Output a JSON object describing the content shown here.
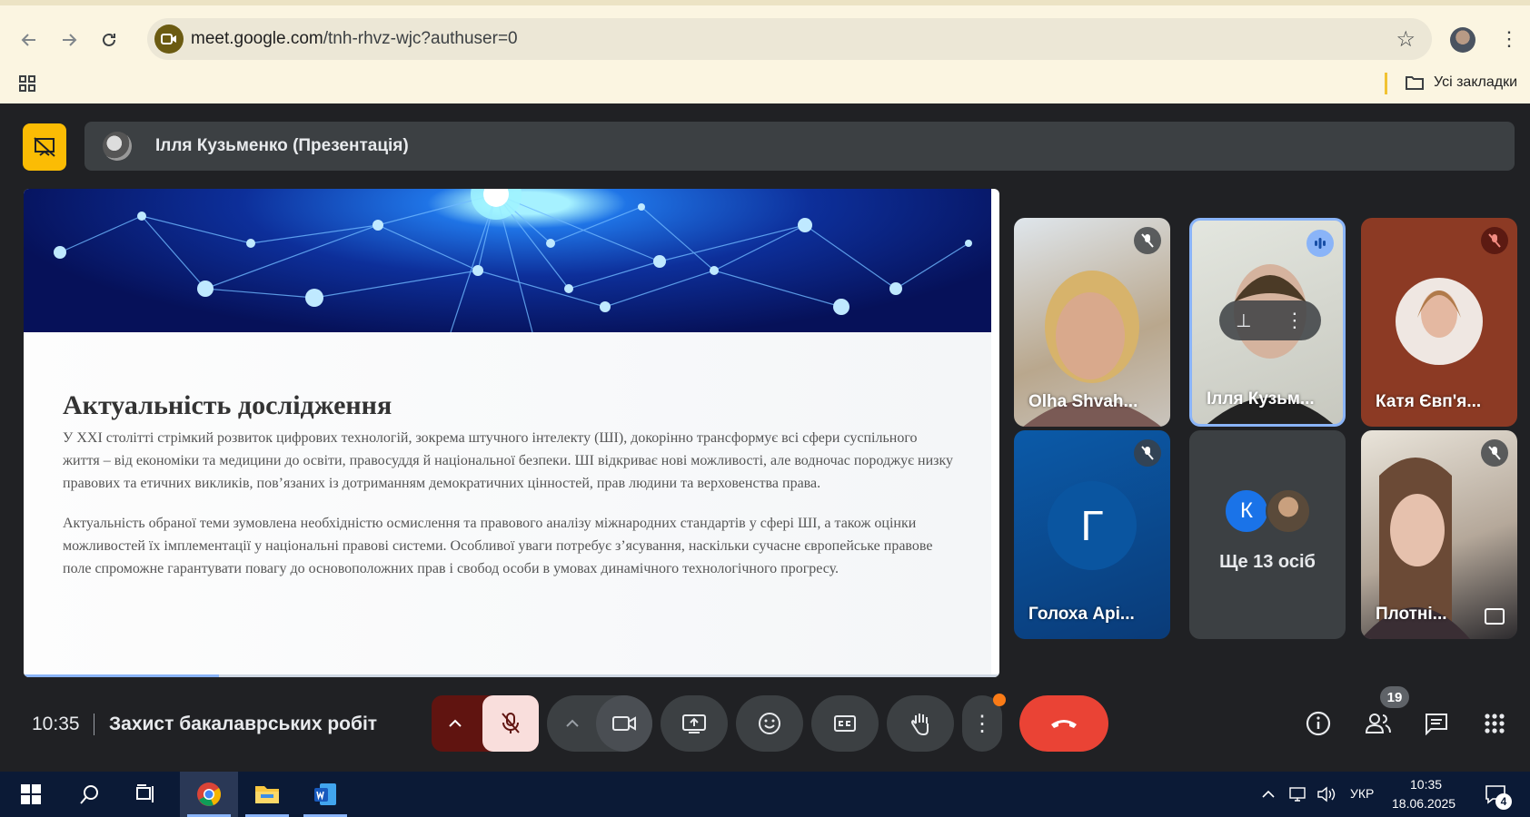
{
  "browser": {
    "url_host": "meet.google.com",
    "url_path": "/tnh-rhvz-wjc?authuser=0",
    "bookmarks_label": "Усі закладки"
  },
  "meet": {
    "presenter_title": "Ілля Кузьменко (Презентація)",
    "slide": {
      "heading": "Актуальність дослідження",
      "paragraph1": "У XXI столітті стрімкий розвиток цифрових технологій, зокрема штучного інтелекту (ШІ), докорінно трансформує всі сфери суспільного життя – від економіки та медицини до освіти, правосуддя й національної безпеки. ШІ відкриває нові можливості, але водночас породжує низку правових та етичних викликів, пов’язаних із дотриманням демократичних цінностей, прав людини та верховенства права.",
      "paragraph2": "Актуальність обраної теми зумовлена необхідністю осмислення та правового аналізу міжнародних стандартів у сфері ШІ, а також оцінки можливостей їх імплементації у національні правові системи. Особливої уваги потребує з’ясування, наскільки сучасне європейське правове поле спроможне гарантувати повагу до основоположних прав і свобод особи в умовах динамічного технологічного прогресу.",
      "progress": 0.2
    },
    "participants": [
      {
        "name": "Olha Shvah...",
        "muted": true
      },
      {
        "name": "Ілля Кузьм...",
        "speaking": true
      },
      {
        "name": "Катя Євп'я...",
        "muted": true
      },
      {
        "name": "Голоха Арі...",
        "initial": "Г",
        "muted": true
      },
      {
        "name": "Ще 13 осіб",
        "initial": "К"
      },
      {
        "name": "Плотні...",
        "muted": true
      }
    ],
    "meeting_time": "10:35",
    "meeting_title": "Захист бакалаврських робіт",
    "people_count": "19"
  },
  "taskbar": {
    "language": "УКР",
    "time": "10:35",
    "date": "18.06.2025",
    "notifications": "4"
  },
  "colors": {
    "meet_bg": "#202124",
    "control_bg": "#3c4043",
    "end_call": "#ea4335",
    "mic_muted_bg": "#f9dedc",
    "mic_muted_group": "#601410",
    "present_badge": "#fbbc04",
    "chrome_bg": "#fbf5e1"
  }
}
